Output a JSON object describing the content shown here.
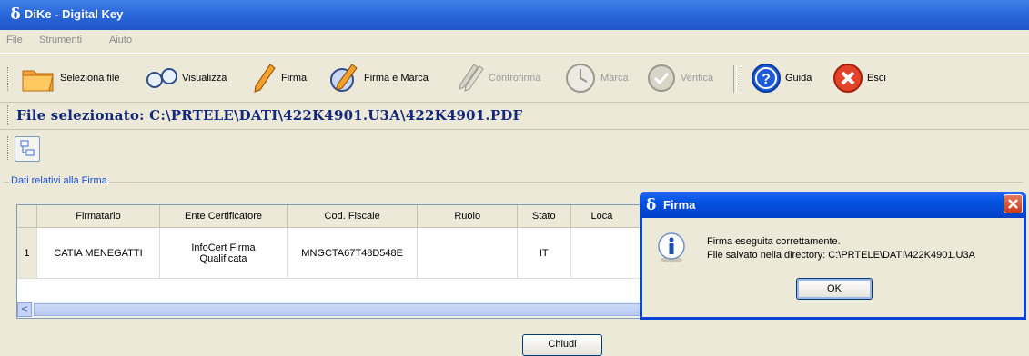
{
  "window": {
    "title": "DiKe - Digital Key"
  },
  "menu": [
    "File",
    "Strumenti",
    "Aiuto"
  ],
  "toolbar": {
    "select_file": "Seleziona file",
    "view": "Visualizza",
    "sign": "Firma",
    "sign_mark": "Firma e Marca",
    "countersign": "Controfirma",
    "mark": "Marca",
    "verify": "Verifica",
    "guide": "Guida",
    "exit": "Esci"
  },
  "file": {
    "label": "File selezionato: C:\\PRTELE\\DATI\\422K4901.U3A\\422K4901.PDF"
  },
  "signature_group": {
    "label": "Dati relativi alla Firma"
  },
  "table": {
    "headers": [
      "Firmatario",
      "Ente Certificatore",
      "Cod. Fiscale",
      "Ruolo",
      "Stato",
      "Loca"
    ],
    "rows": [
      {
        "num": "1",
        "signer": "CATIA MENEGATTI",
        "authority_line1": "InfoCert Firma",
        "authority_line2": "Qualificata",
        "tax_code": "MNGCTA67T48D548E",
        "role": "",
        "state": "IT",
        "place": ""
      }
    ]
  },
  "close_button": "Chiudi",
  "dialog": {
    "title": "Firma",
    "message_line1": "Firma eseguita correttamente.",
    "message_line2": "File salvato nella directory: C:\\PRTELE\\DATI\\422K4901.U3A",
    "ok": "OK"
  },
  "colors": {
    "xp_blue": "#0a45d6",
    "path_text": "#14287a",
    "group_label": "#1a4fcf"
  }
}
